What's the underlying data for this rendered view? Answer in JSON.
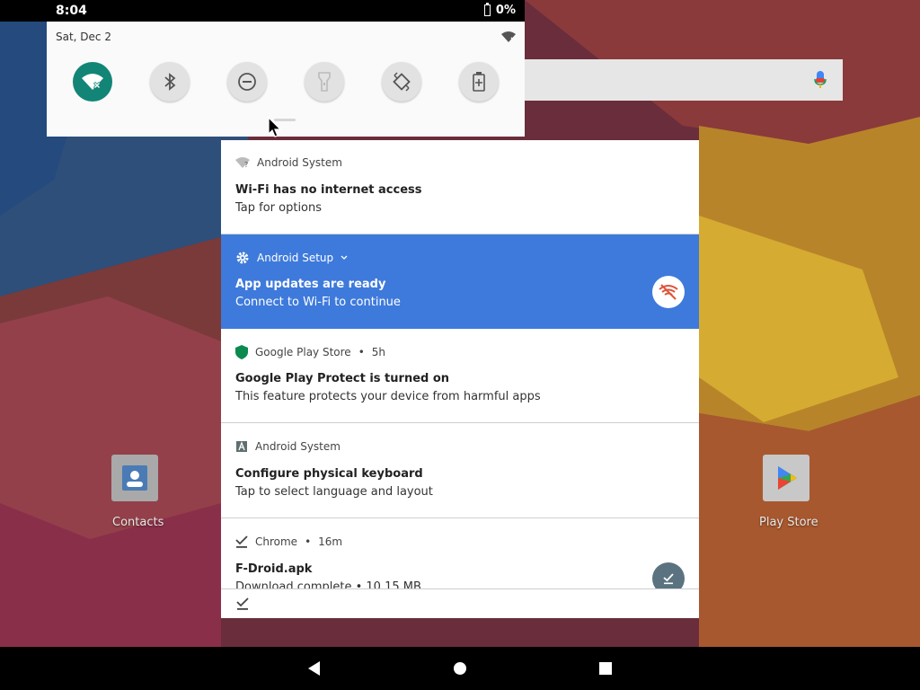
{
  "status_bar": {
    "time": "8:04",
    "battery": "0%"
  },
  "quick_settings": {
    "date": "Sat, Dec 2",
    "tiles": [
      {
        "name": "wifi",
        "icon": "wifi-off-icon",
        "active": true
      },
      {
        "name": "bluetooth",
        "icon": "bluetooth-icon",
        "active": false
      },
      {
        "name": "do-not-disturb",
        "icon": "dnd-icon",
        "active": false
      },
      {
        "name": "flashlight",
        "icon": "flashlight-icon",
        "active": false
      },
      {
        "name": "auto-rotate",
        "icon": "rotate-icon",
        "active": false
      },
      {
        "name": "battery-saver",
        "icon": "battery-saver-icon",
        "active": false
      }
    ],
    "active_color": "#128577"
  },
  "desktop": {
    "apps": [
      {
        "label": "Contacts"
      },
      {
        "label": "Play Store"
      }
    ]
  },
  "notifications": [
    {
      "app": "Android System",
      "title": "Wi-Fi has no internet access",
      "text": "Tap for options",
      "icon": "wifi-question-icon"
    },
    {
      "app": "Android Setup",
      "title": "App updates are ready",
      "text": "Connect to Wi-Fi to continue",
      "icon": "gear-icon",
      "highlight_color": "#3e7adb"
    },
    {
      "app": "Google Play Store",
      "time": "5h",
      "title": "Google Play Protect is turned on",
      "text": "This feature protects your device from harmful apps",
      "icon": "shield-icon"
    },
    {
      "app": "Android System",
      "title": "Configure physical keyboard",
      "text": "Tap to select language and layout",
      "icon": "keyboard-a-icon"
    },
    {
      "app": "Chrome",
      "time": "16m",
      "title": "F-Droid.apk",
      "text": "Download complete • 10.15 MB",
      "icon": "download-done-icon"
    }
  ],
  "separator": "•",
  "nav": {
    "back": "back-icon",
    "home": "home-icon",
    "recents": "recents-icon"
  }
}
